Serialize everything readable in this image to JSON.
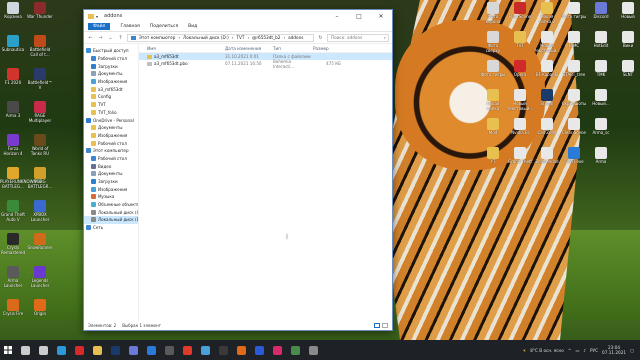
{
  "window": {
    "title": "addons",
    "menu": [
      "Файл",
      "Главная",
      "Поделиться",
      "Вид"
    ],
    "path": [
      "Этот компьютер",
      "Локальный диск (D:)",
      "TVT",
      "@r6553dt_b2",
      "addons"
    ],
    "search_placeholder": "Поиск: addons",
    "columns": [
      "Имя",
      "Дата изменения",
      "Тип",
      "Размер"
    ],
    "files": [
      {
        "name": "a3_mf653dt",
        "date": "31.10.2021 0:01",
        "type": "Папка с файлами",
        "size": ""
      },
      {
        "name": "a3_mf653dt.pbo",
        "date": "07.11.2021 16:50",
        "type": "Bohemia Interacti...",
        "size": "475 КБ"
      }
    ],
    "nav": [
      {
        "label": "Быстрый доступ",
        "color": "#3b8fd9"
      },
      {
        "label": "Рабочий стол",
        "color": "#3a86d0"
      },
      {
        "label": "Загрузки",
        "color": "#2f7fcf"
      },
      {
        "label": "Документы",
        "color": "#8aa0b8"
      },
      {
        "label": "Изображения",
        "color": "#4aa0d8"
      },
      {
        "label": "a3_mf653dt",
        "color": "#e8c050"
      },
      {
        "label": "Config",
        "color": "#e8c050"
      },
      {
        "label": "TVT",
        "color": "#e8c050"
      },
      {
        "label": "TVT_folio",
        "color": "#e8c050"
      },
      {
        "label": "OneDrive - Personal",
        "color": "#2a7ad8"
      },
      {
        "label": "Документы",
        "color": "#e8c050"
      },
      {
        "label": "Изображения",
        "color": "#e8c050"
      },
      {
        "label": "Рабочий стол",
        "color": "#e8c050"
      },
      {
        "label": "Этот компьютер",
        "color": "#3a86d0"
      },
      {
        "label": "Рабочий стол",
        "color": "#3a86d0"
      },
      {
        "label": "Видео",
        "color": "#6b6b9a"
      },
      {
        "label": "Документы",
        "color": "#8aa0b8"
      },
      {
        "label": "Загрузки",
        "color": "#2f7fcf"
      },
      {
        "label": "Изображения",
        "color": "#4aa0d8"
      },
      {
        "label": "Музыка",
        "color": "#d86a3a"
      },
      {
        "label": "Объемные объекты",
        "color": "#4ab0d0"
      },
      {
        "label": "Локальный диск (C:)",
        "color": "#8a8a8a"
      },
      {
        "label": "Локальный диск (D:)",
        "color": "#8a8a8a"
      },
      {
        "label": "Сеть",
        "color": "#3a86d0"
      }
    ],
    "status": [
      "Элементов: 2",
      "Выбран 1 элемент"
    ]
  },
  "desktop_left": [
    {
      "label": "Корзина",
      "color": "#cfd6de"
    },
    {
      "label": "Subnautica",
      "color": "#2aa0c8"
    },
    {
      "label": "F1 2020",
      "color": "#d0342a"
    },
    {
      "label": "Arma 3",
      "color": "#4a4a4a"
    },
    {
      "label": "Forza Horizon 4",
      "color": "#7a3ad0"
    },
    {
      "label": "PLAYERUNKNOWN'S BATTLEG...",
      "color": "#e0a82a"
    },
    {
      "label": "Grand Theft Auto V",
      "color": "#3a8a3a"
    },
    {
      "label": "Crysis Remastered",
      "color": "#2a2a2a"
    },
    {
      "label": "Arma Launcher",
      "color": "#5a5a5a"
    },
    {
      "label": "Crysis Fire",
      "color": "#d86a1a"
    },
    {
      "label": "War Thunder",
      "color": "#8a2a2a"
    },
    {
      "label": "Battlefield Call of t...",
      "color": "#c04a1a"
    },
    {
      "label": "Battlefield™ V",
      "color": "#2a3a6a"
    },
    {
      "label": "RAGE Multiplayer",
      "color": "#c82a4a"
    },
    {
      "label": "World of Tanks RU",
      "color": "#6a4a1a"
    },
    {
      "label": "PUBG BATTLEGR...",
      "color": "#d0a02a"
    },
    {
      "label": "XPBOX Launcher",
      "color": "#3a6ad0"
    },
    {
      "label": "SnowRunner",
      "color": "#d06a1a"
    },
    {
      "label": "Legends Launcher",
      "color": "#6a3ad0"
    },
    {
      "label": "Origin",
      "color": "#e06a1a"
    }
  ],
  "desktop_right": [
    {
      "label": "Фото ворона",
      "color": "#d8d8d8"
    },
    {
      "label": "Фото сверху",
      "color": "#d8d8d8"
    },
    {
      "label": "Фото тигры",
      "color": "#d8d8d8"
    },
    {
      "label": "Новая папка",
      "color": "#e8c050"
    },
    {
      "label": "Mod",
      "color": "#e8c050"
    },
    {
      "label": "YT",
      "color": "#e8c050"
    },
    {
      "label": "FloorScene",
      "color": "#c82a2a"
    },
    {
      "label": "TVT",
      "color": "#e8c050"
    },
    {
      "label": "Opera",
      "color": "#d02a2a"
    },
    {
      "label": "Новый текстовый...",
      "color": "#e8e8e8"
    },
    {
      "label": "Nvidia Bi",
      "color": "#e8e8e8"
    },
    {
      "label": "Grand Theft",
      "color": "#e8e8e8"
    },
    {
      "label": "Новая папка 2",
      "color": "#e8c050"
    },
    {
      "label": "Новый текстовый...",
      "color": "#e8e8e8"
    },
    {
      "label": "BF Kapanki",
      "color": "#e8e8e8"
    },
    {
      "label": "Steam",
      "color": "#1a3a6a"
    },
    {
      "label": "Call Zone",
      "color": "#e8e8e8"
    },
    {
      "label": "Zemil sklad",
      "color": "#e8e8e8"
    },
    {
      "label": "Фото тигры",
      "color": "#e8e8e8"
    },
    {
      "label": "HIMC",
      "color": "#e8e8e8"
    },
    {
      "label": "START_tree",
      "color": "#e8e8e8"
    },
    {
      "label": "Скриншоты",
      "color": "#e8e8e8"
    },
    {
      "label": "Clear Scene",
      "color": "#e8e8e8"
    },
    {
      "label": "OWTI.exe",
      "color": "#2a7ad8"
    },
    {
      "label": "Discord",
      "color": "#6a7ad8"
    },
    {
      "label": "HotEdit",
      "color": "#e8e8e8"
    },
    {
      "label": "TMK",
      "color": "#e8e8e8"
    },
    {
      "label": "Новый...",
      "color": "#e8e8e8"
    },
    {
      "label": "Arma_sc",
      "color": "#e8e8e8"
    },
    {
      "label": "Arma",
      "color": "#e8e8e8"
    },
    {
      "label": "Новый",
      "color": "#e8e8e8"
    },
    {
      "label": "Вики",
      "color": "#e8e8e8"
    },
    {
      "label": "SLNT",
      "color": "#e8e8e8"
    }
  ],
  "taskbar": {
    "apps": [
      {
        "name": "search",
        "color": "#cccccc"
      },
      {
        "name": "task-view",
        "color": "#cccccc"
      },
      {
        "name": "edge",
        "color": "#2a9ad8"
      },
      {
        "name": "opera",
        "color": "#d82a2a"
      },
      {
        "name": "explorer",
        "color": "#e8c050"
      },
      {
        "name": "steam",
        "color": "#1a3a6a"
      },
      {
        "name": "discord",
        "color": "#6a7ad8"
      },
      {
        "name": "vscode",
        "color": "#2a7ad8"
      },
      {
        "name": "arma",
        "color": "#5a5a5a"
      },
      {
        "name": "yandex",
        "color": "#e03a2a"
      },
      {
        "name": "notepad",
        "color": "#4aa0d8"
      },
      {
        "name": "game",
        "color": "#3a3a3a"
      },
      {
        "name": "origin",
        "color": "#e06a1a"
      },
      {
        "name": "ubisoft",
        "color": "#2a5ad8"
      },
      {
        "name": "music",
        "color": "#d82a6a"
      },
      {
        "name": "app",
        "color": "#4a8a4a"
      },
      {
        "name": "app2",
        "color": "#8a8a8a"
      }
    ],
    "weather": "8°C В осн. ясно",
    "time": "23:04",
    "date": "07.11.2021"
  }
}
